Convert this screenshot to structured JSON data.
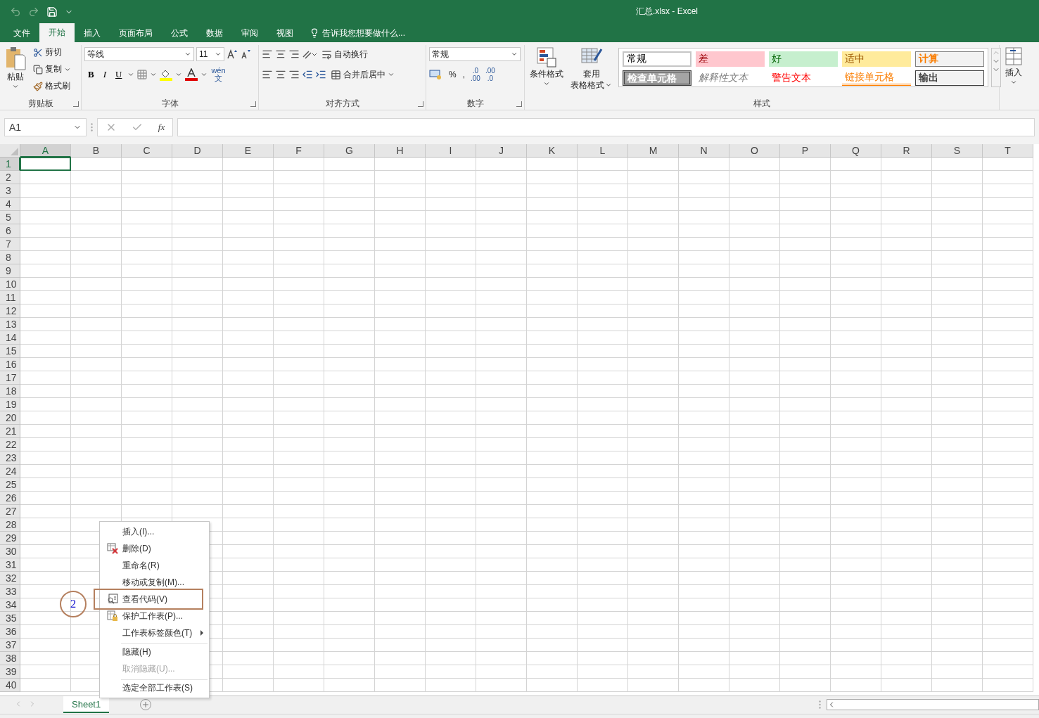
{
  "title": "汇总.xlsx - Excel",
  "menu_tabs": [
    {
      "label": "文件",
      "selected": false
    },
    {
      "label": "开始",
      "selected": true
    },
    {
      "label": "插入",
      "selected": false
    },
    {
      "label": "页面布局",
      "selected": false
    },
    {
      "label": "公式",
      "selected": false
    },
    {
      "label": "数据",
      "selected": false
    },
    {
      "label": "审阅",
      "selected": false
    },
    {
      "label": "视图",
      "selected": false
    }
  ],
  "tell_me": "告诉我您想要做什么...",
  "clipboard": {
    "paste": "粘贴",
    "cut": "剪切",
    "copy": "复制",
    "format_painter": "格式刷",
    "group": "剪贴板"
  },
  "font": {
    "name": "等线",
    "size": "11",
    "bold": "B",
    "italic": "I",
    "underline": "U",
    "phonetic_top": "wén",
    "phonetic_bottom": "文",
    "group": "字体"
  },
  "alignment": {
    "wrap": "自动换行",
    "merge": "合并后居中",
    "group": "对齐方式"
  },
  "number": {
    "format": "常规",
    "percent": "%",
    "comma": ",",
    "increase_decimal": {
      "top": ".0",
      "bottom": ".00"
    },
    "decrease_decimal": {
      "top": ".00",
      "bottom": ".0"
    },
    "group": "数字"
  },
  "styles": {
    "conditional": "条件格式",
    "table_top": "套用",
    "table_bottom": "表格格式",
    "group": "样式",
    "cells": [
      {
        "label": "常规",
        "kind": "normal"
      },
      {
        "label": "差",
        "kind": "bad"
      },
      {
        "label": "好",
        "kind": "good"
      },
      {
        "label": "适中",
        "kind": "neutral"
      },
      {
        "label": "计算",
        "kind": "calc"
      },
      {
        "label": "检查单元格",
        "kind": "check"
      },
      {
        "label": "解释性文本",
        "kind": "explanatory"
      },
      {
        "label": "警告文本",
        "kind": "warning"
      },
      {
        "label": "链接单元格",
        "kind": "link"
      },
      {
        "label": "输出",
        "kind": "output"
      }
    ]
  },
  "cells_group": {
    "insert": "插入"
  },
  "formula_bar": {
    "name_box": "A1",
    "fx": "fx"
  },
  "columns": [
    {
      "label": "A",
      "selected": true
    },
    {
      "label": "B",
      "selected": false
    },
    {
      "label": "C",
      "selected": false
    },
    {
      "label": "D",
      "selected": false
    },
    {
      "label": "E",
      "selected": false
    },
    {
      "label": "F",
      "selected": false
    },
    {
      "label": "G",
      "selected": false
    },
    {
      "label": "H",
      "selected": false
    },
    {
      "label": "I",
      "selected": false
    },
    {
      "label": "J",
      "selected": false
    },
    {
      "label": "K",
      "selected": false
    },
    {
      "label": "L",
      "selected": false
    },
    {
      "label": "M",
      "selected": false
    },
    {
      "label": "N",
      "selected": false
    },
    {
      "label": "O",
      "selected": false
    },
    {
      "label": "P",
      "selected": false
    },
    {
      "label": "Q",
      "selected": false
    },
    {
      "label": "R",
      "selected": false
    },
    {
      "label": "S",
      "selected": false
    },
    {
      "label": "T",
      "selected": false
    }
  ],
  "rows": [
    {
      "label": "1",
      "selected": true
    },
    {
      "label": "2",
      "selected": false
    },
    {
      "label": "3",
      "selected": false
    },
    {
      "label": "4",
      "selected": false
    },
    {
      "label": "5",
      "selected": false
    },
    {
      "label": "6",
      "selected": false
    },
    {
      "label": "7",
      "selected": false
    },
    {
      "label": "8",
      "selected": false
    },
    {
      "label": "9",
      "selected": false
    },
    {
      "label": "10",
      "selected": false
    },
    {
      "label": "11",
      "selected": false
    },
    {
      "label": "12",
      "selected": false
    },
    {
      "label": "13",
      "selected": false
    },
    {
      "label": "14",
      "selected": false
    },
    {
      "label": "15",
      "selected": false
    },
    {
      "label": "16",
      "selected": false
    },
    {
      "label": "17",
      "selected": false
    },
    {
      "label": "18",
      "selected": false
    },
    {
      "label": "19",
      "selected": false
    },
    {
      "label": "20",
      "selected": false
    },
    {
      "label": "21",
      "selected": false
    },
    {
      "label": "22",
      "selected": false
    },
    {
      "label": "23",
      "selected": false
    },
    {
      "label": "24",
      "selected": false
    },
    {
      "label": "25",
      "selected": false
    },
    {
      "label": "26",
      "selected": false
    },
    {
      "label": "27",
      "selected": false
    },
    {
      "label": "28",
      "selected": false
    },
    {
      "label": "29",
      "selected": false
    },
    {
      "label": "30",
      "selected": false
    },
    {
      "label": "31",
      "selected": false
    },
    {
      "label": "32",
      "selected": false
    },
    {
      "label": "33",
      "selected": false
    },
    {
      "label": "34",
      "selected": false
    },
    {
      "label": "35",
      "selected": false
    },
    {
      "label": "36",
      "selected": false
    },
    {
      "label": "37",
      "selected": false
    },
    {
      "label": "38",
      "selected": false
    },
    {
      "label": "39",
      "selected": false
    },
    {
      "label": "40",
      "selected": false
    }
  ],
  "sheet_tabs": [
    {
      "label": "Sheet1",
      "selected": true
    }
  ],
  "context_menu": [
    {
      "label": "插入(I)...",
      "kind": "plain",
      "disabled": false,
      "submenu": false,
      "separator_before": false
    },
    {
      "label": "删除(D)",
      "kind": "delete",
      "disabled": false,
      "submenu": false,
      "separator_before": false
    },
    {
      "label": "重命名(R)",
      "kind": "plain",
      "disabled": false,
      "submenu": false,
      "separator_before": false
    },
    {
      "label": "移动或复制(M)...",
      "kind": "plain",
      "disabled": false,
      "submenu": false,
      "separator_before": false
    },
    {
      "label": "查看代码(V)",
      "kind": "code",
      "disabled": false,
      "submenu": false,
      "separator_before": false
    },
    {
      "label": "保护工作表(P)...",
      "kind": "protect",
      "disabled": false,
      "submenu": false,
      "separator_before": false
    },
    {
      "label": "工作表标签颜色(T)",
      "kind": "plain",
      "disabled": false,
      "submenu": true,
      "separator_before": false
    },
    {
      "label": "隐藏(H)",
      "kind": "plain",
      "disabled": false,
      "submenu": false,
      "separator_before": true
    },
    {
      "label": "取消隐藏(U)...",
      "kind": "plain",
      "disabled": true,
      "submenu": false,
      "separator_before": false
    },
    {
      "label": "选定全部工作表(S)",
      "kind": "plain",
      "disabled": false,
      "submenu": false,
      "separator_before": true
    }
  ],
  "annotation": {
    "label": "2"
  }
}
